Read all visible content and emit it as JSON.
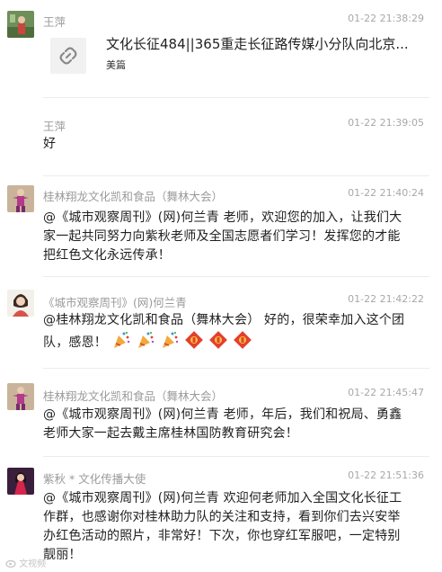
{
  "messages": [
    {
      "sender": "王萍",
      "time": "01-22 21:38:29",
      "link": {
        "title": "文化长征484||365重走长征路传媒小分队向北京...",
        "source": "美篇",
        "icon": "link-icon"
      }
    },
    {
      "sender": "王萍",
      "time": "01-22 21:39:05",
      "text": "好"
    },
    {
      "sender": "桂林翔龙文化凯和食品（舞林大会）",
      "time": "01-22 21:40:24",
      "lines": [
        "@《城市观察周刊》(网)何兰青 老师，欢迎您的加入，让我们大",
        "家一起共同努力向紫秋老师及全国志愿者们学习！发挥您的才能",
        "把红色文化永远传承！"
      ]
    },
    {
      "sender": "《城市观察周刊》(网)何兰青",
      "time": "01-22 21:42:22",
      "lines": [
        "@桂林翔龙文化凯和食品（舞林大会） 好的，很荣幸加入这个团",
        "队，感恩！"
      ],
      "emoji": [
        "party-popper",
        "party-popper",
        "party-popper",
        "fu-blessing",
        "fu-blessing",
        "fu-blessing"
      ]
    },
    {
      "sender": "桂林翔龙文化凯和食品（舞林大会）",
      "time": "01-22 21:45:47",
      "lines": [
        "@《城市观察周刊》(网)何兰青 老师，年后，我们和祝局、勇鑫",
        "老师大家一起去戴主席桂林国防教育研究会！"
      ]
    },
    {
      "sender": "紫秋 * 文化传播大使",
      "time": "01-22 21:51:36",
      "lines": [
        "@《城市观察周刊》(网)何兰青 欢迎何老师加入全国文化长征工",
        "作群，也感谢你对桂林助力队的关注和支持，看到你们去兴安举",
        "办红色活动的照片，非常好！下次，你也穿红军服吧，一定特别",
        "靓丽！"
      ]
    }
  ],
  "watermark": "文视频"
}
